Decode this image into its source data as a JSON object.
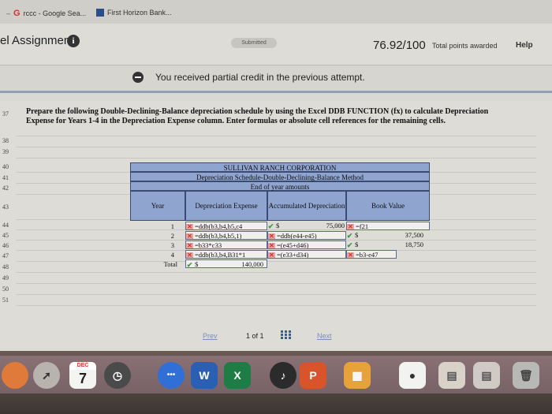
{
  "bookmarks": [
    {
      "icon": "google-icon",
      "label": "rccc - Google Sea..."
    },
    {
      "icon": "first-horizon-icon",
      "label": "First Horizon Bank..."
    }
  ],
  "header": {
    "title": "el Assignment",
    "status": "Submitted",
    "score": "76.92/100",
    "score_label": "Total points awarded",
    "help": "Help"
  },
  "notice": {
    "text": "You received partial credit in the previous attempt."
  },
  "sheet": {
    "row_numbers": [
      "37",
      "38",
      "39",
      "40",
      "41",
      "42",
      "43",
      "44",
      "45",
      "46",
      "47",
      "48",
      "49",
      "50",
      "51"
    ],
    "prompt": "Prepare the following Double-Declining-Balance depreciation schedule by using the Excel DDB FUNCTION (fx) to calculate Depreciation Expense for Years 1-4 in the Depreciation Expense column. Enter formulas or absolute cell references for the remaining cells.",
    "table": {
      "company": "SULLIVAN RANCH CORPORATION",
      "subtitle": "Depreciation Schedule-Double-Declining-Balance Method",
      "period": "End of year amounts",
      "col_year": "Year",
      "col_dep": "Depreciation Expense",
      "col_acc": "Accumulated Depreciation",
      "col_book": "Book Value",
      "rows": [
        {
          "year": "1",
          "dep": "=ddb(b3,b4,b5,c4",
          "acc_prefix": "$",
          "acc": "75,000",
          "book": "=f21",
          "dep_mark": "x",
          "acc_mark": "ok",
          "book_mark": "x"
        },
        {
          "year": "2",
          "dep": "=ddb(b3,b4,b5,1)",
          "acc_prefix": "",
          "acc": "=ddb(e44-e45)",
          "book_prefix": "$",
          "book": "37,500",
          "dep_mark": "x",
          "acc_mark": "x",
          "book_mark": "ok"
        },
        {
          "year": "3",
          "dep": "=b33*c33",
          "acc_prefix": "",
          "acc": "=(e45+d46)",
          "book_prefix": "$",
          "book": "18,750",
          "dep_mark": "x",
          "acc_mark": "x",
          "book_mark": "ok"
        },
        {
          "year": "4",
          "dep": "=ddb(b3,b4,B31*1",
          "acc_prefix": "",
          "acc": "=(e33+d34)",
          "book": "=b3-e47",
          "dep_mark": "x",
          "acc_mark": "x",
          "book_mark": "x"
        }
      ],
      "total_label": "Total",
      "total_prefix": "$",
      "total_value": "140,000"
    }
  },
  "pager": {
    "prev": "Prev",
    "page": "1 of 1",
    "next": "Next"
  },
  "dock": {
    "calendar_month": "DEC",
    "calendar_day": "7",
    "word": "W",
    "excel": "X",
    "powerpoint": "P"
  }
}
